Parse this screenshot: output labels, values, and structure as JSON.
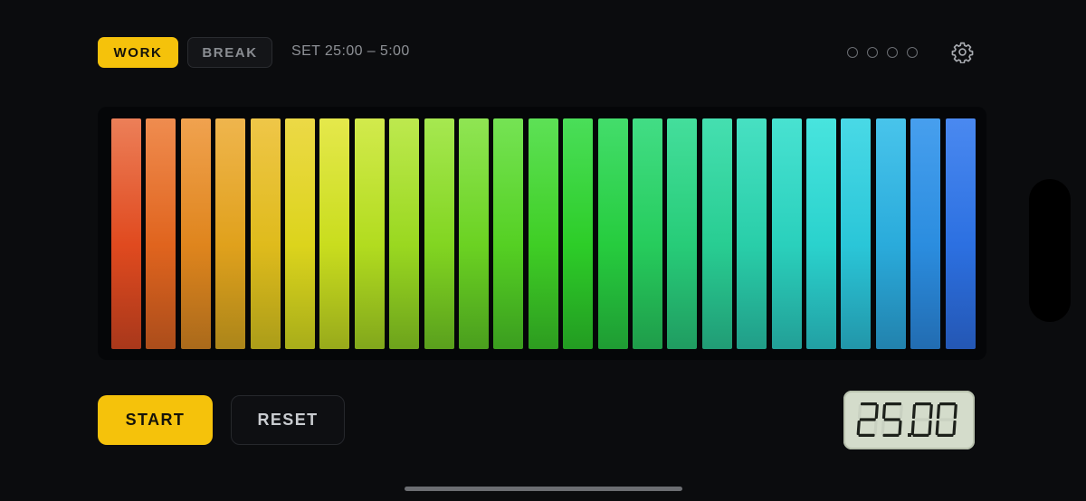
{
  "modes": {
    "work_label": "WORK",
    "break_label": "BREAK",
    "active": "WORK"
  },
  "set_label": "SET 25:00 – 5:00",
  "session_dots": {
    "total": 4,
    "completed": 0
  },
  "settings_icon": "gear-icon",
  "progress_bars": {
    "count": 25,
    "remaining_fraction": 1.0,
    "colors_top": [
      "#ec7f58",
      "#ef8c4f",
      "#f0a24f",
      "#efb54d",
      "#efc648",
      "#ecd946",
      "#e5e84b",
      "#d2ea4c",
      "#bde94e",
      "#a6e850",
      "#8fe553",
      "#75e354",
      "#5de156",
      "#4ade59",
      "#43dd6b",
      "#42dd85",
      "#44de9c",
      "#45dfb0",
      "#47e0c2",
      "#48e2d1",
      "#48e4de",
      "#49d9e6",
      "#48c4eb",
      "#479fee",
      "#4a89f0"
    ],
    "colors_mid": [
      "#e04a1f",
      "#e0641e",
      "#df851d",
      "#e0a11c",
      "#dfbb1c",
      "#dcd41c",
      "#c9dd1e",
      "#b2dc1f",
      "#9ad820",
      "#82d521",
      "#6bd222",
      "#55d023",
      "#3fce25",
      "#2dcd28",
      "#26cc3e",
      "#26cc5c",
      "#27cc78",
      "#28cd92",
      "#29cea9",
      "#2ad0bc",
      "#2ad2cd",
      "#2ac6d8",
      "#2aabdb",
      "#2b8ddf",
      "#2c70e1"
    ],
    "colors_bottom": [
      "#a8381b",
      "#ab4d1b",
      "#aa6a1b",
      "#ab851a",
      "#ab9d19",
      "#a8ad1a",
      "#98aa1b",
      "#82a71c",
      "#6da31c",
      "#5aa01d",
      "#4a9e1e",
      "#3b9d1f",
      "#2d9c20",
      "#239c22",
      "#1f9c33",
      "#1f9c4a",
      "#209c61",
      "#219c75",
      "#219d87",
      "#229f96",
      "#22a0a3",
      "#2296a9",
      "#2282ad",
      "#226cb1",
      "#2457b4"
    ]
  },
  "buttons": {
    "start_label": "START",
    "reset_label": "RESET"
  },
  "timer_display": "25.00"
}
